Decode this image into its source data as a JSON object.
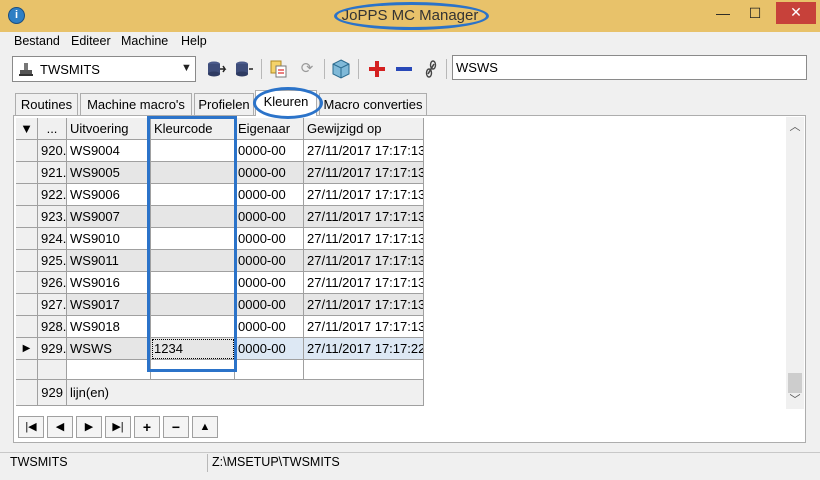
{
  "window": {
    "title": "JoPPS MC Manager",
    "minimize_glyph": "—",
    "maximize_glyph": "☐",
    "close_glyph": "✕",
    "icon_glyph": "i"
  },
  "menu": [
    "Bestand",
    "Editeer",
    "Machine",
    "Help"
  ],
  "toolbar": {
    "machine_combo_value": "TWSMITS",
    "search_value": "WSWS"
  },
  "tabs": [
    "Routines",
    "Machine macro's",
    "Profielen",
    "Kleuren",
    "Macro converties"
  ],
  "active_tab": "Kleuren",
  "grid": {
    "columns": [
      "...",
      "Uitvoering",
      "Kleurcode",
      "Eigenaar",
      "Gewijzigd op"
    ],
    "rows": [
      {
        "num": "920.",
        "uitvoering": "WS9004",
        "kleurcode": "",
        "eigenaar": "0000-00",
        "gewijzigd": "27/11/2017 17:17:13"
      },
      {
        "num": "921.",
        "uitvoering": "WS9005",
        "kleurcode": "",
        "eigenaar": "0000-00",
        "gewijzigd": "27/11/2017 17:17:13"
      },
      {
        "num": "922.",
        "uitvoering": "WS9006",
        "kleurcode": "",
        "eigenaar": "0000-00",
        "gewijzigd": "27/11/2017 17:17:13"
      },
      {
        "num": "923.",
        "uitvoering": "WS9007",
        "kleurcode": "",
        "eigenaar": "0000-00",
        "gewijzigd": "27/11/2017 17:17:13"
      },
      {
        "num": "924.",
        "uitvoering": "WS9010",
        "kleurcode": "",
        "eigenaar": "0000-00",
        "gewijzigd": "27/11/2017 17:17:13"
      },
      {
        "num": "925.",
        "uitvoering": "WS9011",
        "kleurcode": "",
        "eigenaar": "0000-00",
        "gewijzigd": "27/11/2017 17:17:13"
      },
      {
        "num": "926.",
        "uitvoering": "WS9016",
        "kleurcode": "",
        "eigenaar": "0000-00",
        "gewijzigd": "27/11/2017 17:17:13"
      },
      {
        "num": "927.",
        "uitvoering": "WS9017",
        "kleurcode": "",
        "eigenaar": "0000-00",
        "gewijzigd": "27/11/2017 17:17:13"
      },
      {
        "num": "928.",
        "uitvoering": "WS9018",
        "kleurcode": "",
        "eigenaar": "0000-00",
        "gewijzigd": "27/11/2017 17:17:13"
      },
      {
        "num": "929.",
        "uitvoering": "WSWS",
        "kleurcode": "1234",
        "eigenaar": "0000-00",
        "gewijzigd": "27/11/2017 17:17:22"
      }
    ],
    "footer_count": "929",
    "footer_label": "lijn(en)",
    "header_indicator": "▼",
    "current_row_indicator": "▶"
  },
  "nav_buttons": [
    "|◀",
    "◀",
    "▶",
    "▶|",
    "+",
    "−",
    "▲"
  ],
  "status_bar": {
    "left": "TWSMITS",
    "path": "Z:\\MSETUP\\TWSMITS"
  },
  "icons": [
    "app-info-icon",
    "machine-icon",
    "db-export-icon",
    "db-import-icon",
    "copy-icon",
    "refresh-icon",
    "package-icon",
    "add-icon",
    "remove-icon",
    "link-icon"
  ],
  "colors": {
    "title_bar": "#e8c26a",
    "highlight_ring": "#2b73c9",
    "add_red": "#d42020",
    "remove_blue": "#2848b8"
  }
}
